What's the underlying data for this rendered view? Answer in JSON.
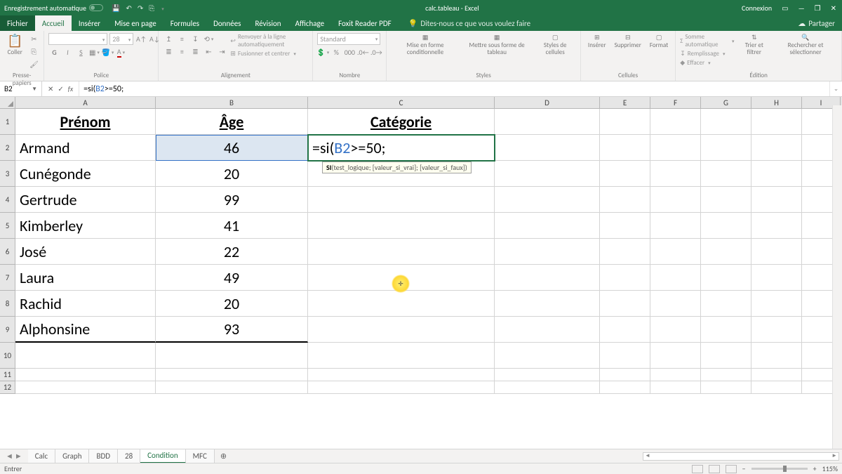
{
  "titlebar": {
    "autosave": "Enregistrement automatique",
    "doc_title": "calc.tableau - Excel",
    "signin": "Connexion"
  },
  "tabs": {
    "file": "Fichier",
    "home": "Accueil",
    "insert": "Insérer",
    "layout": "Mise en page",
    "formulas": "Formules",
    "data": "Données",
    "review": "Révision",
    "view": "Affichage",
    "foxit": "Foxit Reader PDF",
    "tell": "Dites-nous ce que vous voulez faire",
    "share": "Partager"
  },
  "ribbon": {
    "paste": "Coller",
    "clipboard": "Presse-papiers",
    "font_name": "",
    "font_size": "28",
    "font": "Police",
    "wrap": "Renvoyer à la ligne automatiquement",
    "merge": "Fusionner et centrer",
    "alignment": "Alignement",
    "numfmt": "Standard",
    "number": "Nombre",
    "cond": "Mise en forme conditionnelle",
    "table": "Mettre sous forme de tableau",
    "cellstyle": "Styles de cellules",
    "styles": "Styles",
    "ins": "Insérer",
    "del": "Supprimer",
    "fmt": "Format",
    "cells": "Cellules",
    "sum": "Somme automatique",
    "fill": "Remplissage",
    "clear": "Effacer",
    "sort": "Trier et filtrer",
    "find": "Rechercher et sélectionner",
    "editing": "Édition"
  },
  "formula": {
    "namebox": "B2",
    "text_prefix": "=si(",
    "text_ref": "B2",
    "text_suffix": ">=50;"
  },
  "columns": [
    "A",
    "B",
    "C",
    "D",
    "E",
    "F",
    "G",
    "H",
    "I"
  ],
  "headers": {
    "A": "Prénom",
    "B": "Âge",
    "C": "Catégorie"
  },
  "data_rows": [
    {
      "A": "Armand",
      "B": "46"
    },
    {
      "A": "Cunégonde",
      "B": "20"
    },
    {
      "A": "Gertrude",
      "B": "99"
    },
    {
      "A": "Kimberley",
      "B": "41"
    },
    {
      "A": "José",
      "B": "22"
    },
    {
      "A": "Laura",
      "B": "49"
    },
    {
      "A": "Rachid",
      "B": "20"
    },
    {
      "A": "Alphonsine",
      "B": "93"
    }
  ],
  "editing_cell": {
    "prefix": "=si(",
    "ref": "B2",
    "suffix": ">=50;"
  },
  "fn_tip": {
    "fn": "SI",
    "args": "(test_logique; [valeur_si_vrai]; [valeur_si_faux])"
  },
  "sheets": [
    "Calc",
    "Graph",
    "BDD",
    "28",
    "Condition",
    "MFC"
  ],
  "active_sheet": "Condition",
  "status": {
    "mode": "Entrer",
    "zoom": "115%"
  }
}
